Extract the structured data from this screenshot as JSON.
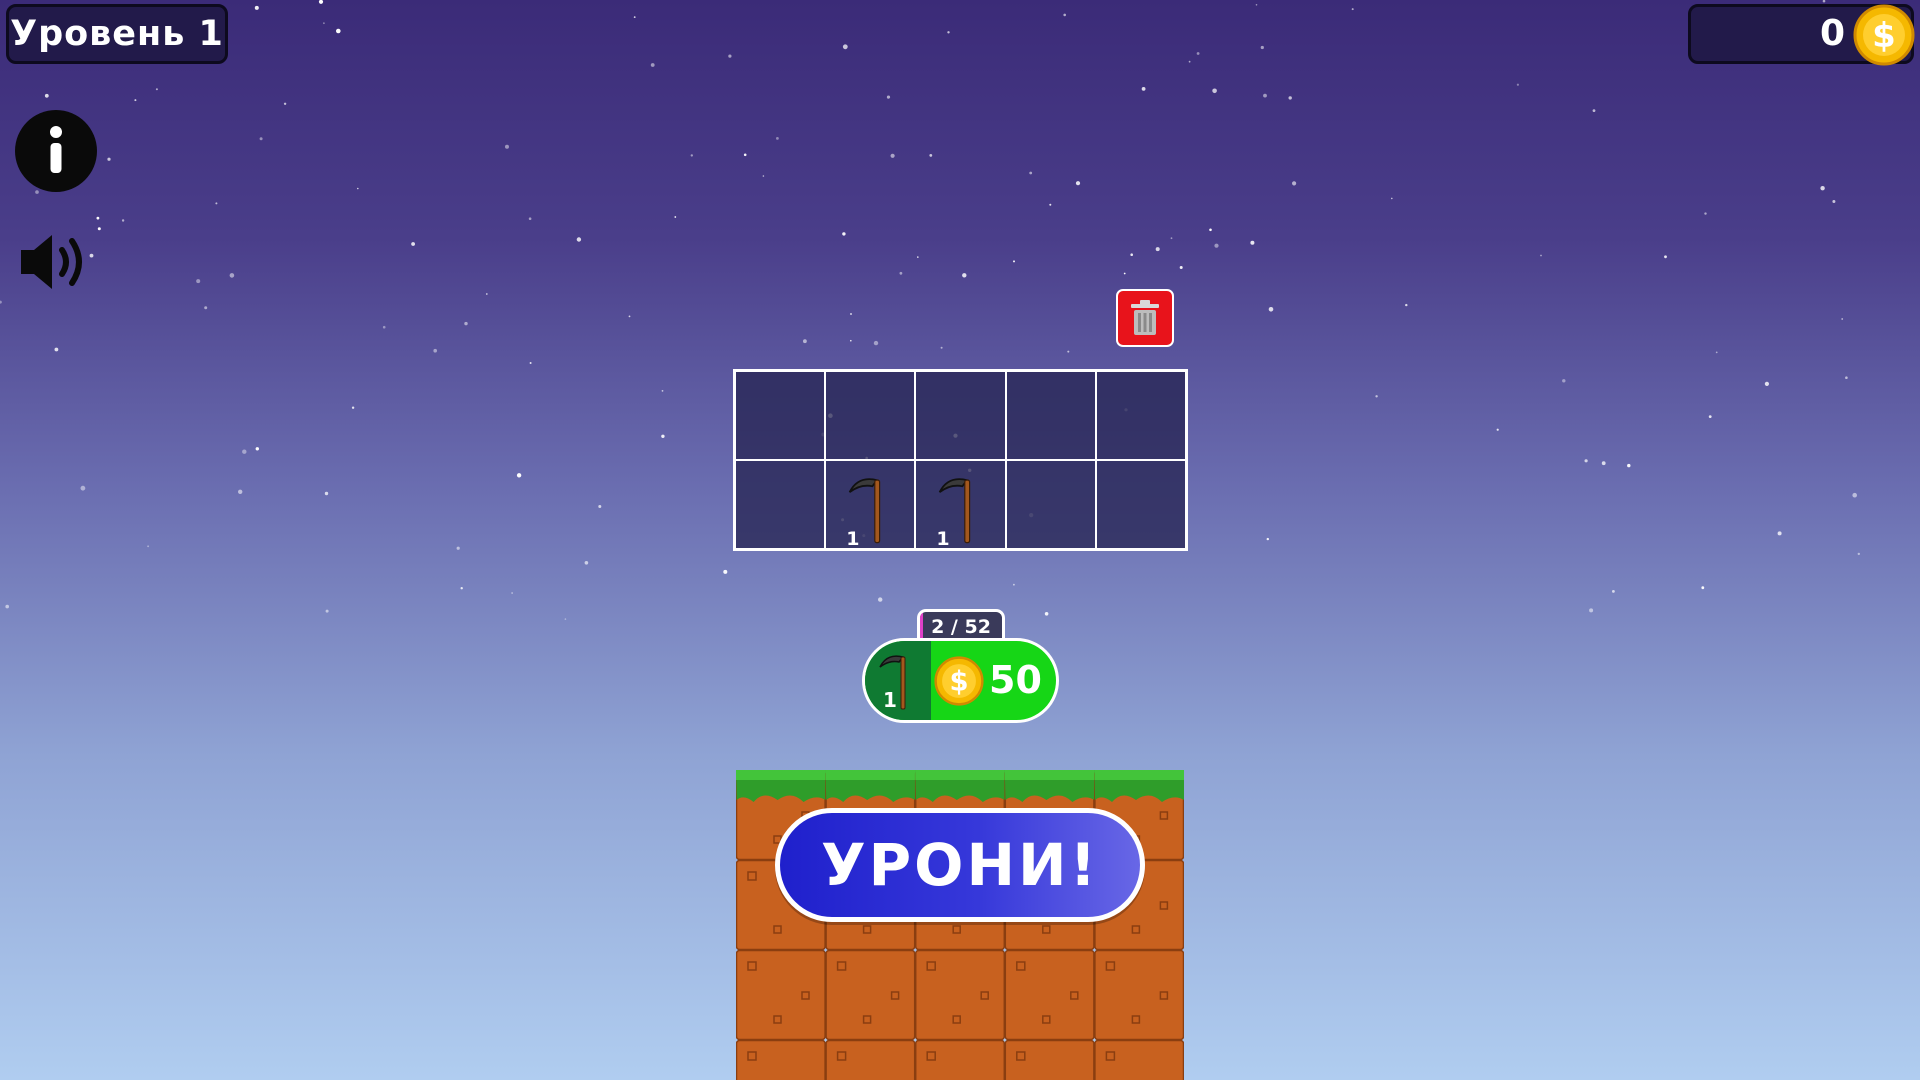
{
  "hud": {
    "level_label": "Уровень 1",
    "coins": "0"
  },
  "controls": {
    "info_icon": "info-icon",
    "sound_icon": "speaker-icon",
    "trash_icon": "trash-icon"
  },
  "inventory": {
    "cells": [
      {
        "item": "",
        "count": ""
      },
      {
        "item": "",
        "count": ""
      },
      {
        "item": "",
        "count": ""
      },
      {
        "item": "",
        "count": ""
      },
      {
        "item": "",
        "count": ""
      },
      {
        "item": "",
        "count": ""
      },
      {
        "item": "scythe",
        "count": "1"
      },
      {
        "item": "scythe",
        "count": "1"
      },
      {
        "item": "",
        "count": ""
      },
      {
        "item": "",
        "count": ""
      }
    ]
  },
  "shop": {
    "progress_text": "2 / 52",
    "progress_fraction": 0.038,
    "item_qty": "1",
    "price": "50"
  },
  "drop_button_label": "УРОНИ!",
  "colors": {
    "accent_green": "#16d616",
    "dark_green": "#0f7a32",
    "trash_red": "#e8131b",
    "drop_blue": "#2a2bd4",
    "coin_gold": "#f5b800"
  }
}
